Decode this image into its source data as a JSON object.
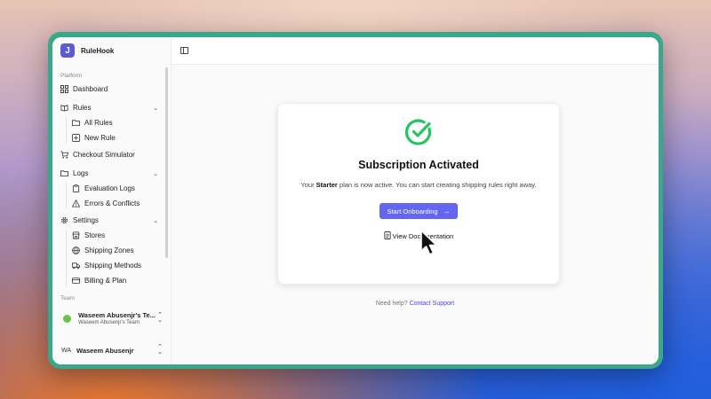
{
  "app": {
    "name": "RuleHook",
    "logo_glyph": "J"
  },
  "sidebar": {
    "platform_label": "Platform",
    "dashboard": "Dashboard",
    "rules": {
      "label": "Rules",
      "items": [
        "All Rules",
        "New Rule"
      ]
    },
    "checkout_simulator": "Checkout Simulator",
    "logs": {
      "label": "Logs",
      "items": [
        "Evaluation Logs",
        "Errors & Conflicts"
      ]
    },
    "settings": {
      "label": "Settings",
      "items": [
        "Stores",
        "Shipping Zones",
        "Shipping Methods",
        "Billing & Plan"
      ]
    },
    "team_label": "Team",
    "team": {
      "name": "Waseem Abusenjr's Te...",
      "sub": "Waseem Abusenjr's Team"
    },
    "user": {
      "initials": "WA",
      "name": "Waseem Abusenjr"
    }
  },
  "card": {
    "title": "Subscription Activated",
    "desc_prefix": "Your ",
    "plan": "Starter",
    "desc_suffix": " plan is now active. You can start creating shipping rules right away.",
    "cta_label": "Start Onboarding",
    "docs_label": "View Documentation"
  },
  "help": {
    "prefix": "Need help? ",
    "link": "Contact Support"
  },
  "colors": {
    "accent": "#6366f1",
    "success": "#22c55e",
    "frame": "#3aa68a"
  }
}
